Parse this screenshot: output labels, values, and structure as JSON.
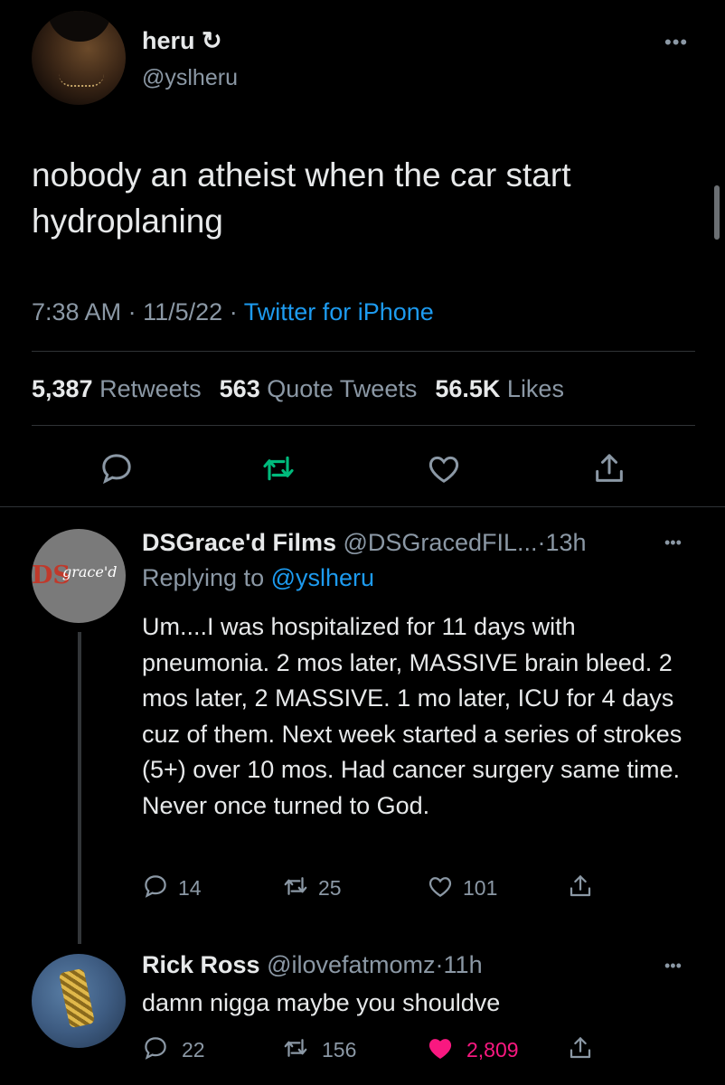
{
  "main_tweet": {
    "display_name": "heru ↻",
    "handle": "@yslheru",
    "text": "nobody an atheist when the car start hydroplaning",
    "time": "7:38 AM",
    "sep1": "·",
    "date": "11/5/22",
    "sep2": "·",
    "source": "Twitter for iPhone",
    "retweets_count": "5,387",
    "retweets_label": "Retweets",
    "quotes_count": "563",
    "quotes_label": "Quote Tweets",
    "likes_count": "56.5K",
    "likes_label": "Likes",
    "more": "•••"
  },
  "replies": [
    {
      "display_name": "DSGrace'd Films",
      "handle": "@DSGracedFIL...",
      "sep": "·",
      "time": "13h",
      "replying_prefix": "Replying to",
      "replying_to": "@yslheru",
      "text": "Um....I was hospitalized for 11 days with pneumonia. 2 mos later, MASSIVE brain bleed. 2 mos later, 2 MASSIVE.  1 mo later, ICU for 4 days cuz of them.  Next week started a series of strokes (5+) over 10 mos. Had cancer surgery same time. Never once turned to God.",
      "replies": "14",
      "retweets": "25",
      "likes": "101",
      "more": "•••",
      "avatar_logo": "DS",
      "avatar_script": "grace'd"
    },
    {
      "display_name": "Rick Ross",
      "handle": "@ilovefatmomz",
      "sep": "·",
      "time": "11h",
      "text": "damn nigga maybe you shouldve",
      "replies": "22",
      "retweets": "156",
      "likes": "2,809",
      "liked": true,
      "more": "•••"
    }
  ],
  "colors": {
    "background": "#000000",
    "text": "#e7e9ea",
    "muted": "#8b98a5",
    "link": "#1d9bf0",
    "retweet_green": "#00ba7c",
    "like_pink": "#f91880"
  },
  "icons": {
    "reply": "reply-icon",
    "retweet": "retweet-icon",
    "like": "heart-icon",
    "share": "share-icon"
  }
}
